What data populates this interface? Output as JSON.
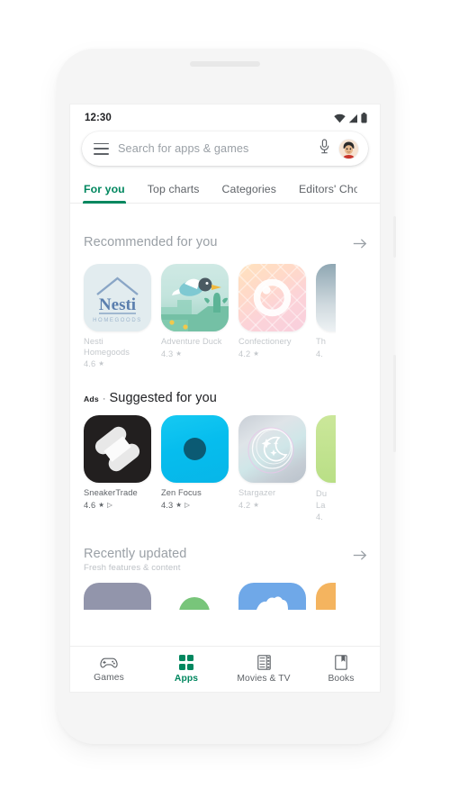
{
  "status_bar": {
    "time": "12:30",
    "icons": [
      "wifi-icon",
      "signal-icon",
      "battery-icon"
    ]
  },
  "search": {
    "menu_icon": "hamburger-menu-icon",
    "placeholder": "Search for apps & games",
    "mic_icon": "microphone-icon",
    "avatar": "user-avatar"
  },
  "tabs": [
    {
      "label": "For you",
      "active": true
    },
    {
      "label": "Top charts",
      "active": false
    },
    {
      "label": "Categories",
      "active": false
    },
    {
      "label": "Editors' Choi",
      "active": false
    }
  ],
  "colors": {
    "accent_green": "#01875f",
    "text_primary": "#202124",
    "text_secondary": "#5f6368",
    "text_muted": "#9aa0a6"
  },
  "sections": {
    "recommended": {
      "title": "Recommended for you",
      "arrow_icon": "arrow-right-icon",
      "apps": [
        {
          "name": "Nesti Homegoods",
          "rating": "4.6",
          "star": "★",
          "icon": "nesti-homegoods-icon"
        },
        {
          "name": "Adventure Duck",
          "rating": "4.3",
          "star": "★",
          "icon": "adventure-duck-icon"
        },
        {
          "name": "Confectionery",
          "rating": "4.2",
          "star": "★",
          "icon": "confectionery-icon"
        },
        {
          "name": "Th",
          "rating": "4.",
          "star": "",
          "icon": "partial-app-icon"
        }
      ]
    },
    "suggested": {
      "ads_tag": "Ads",
      "separator": "·",
      "title": "Suggested for you",
      "apps": [
        {
          "name": "SneakerTrade",
          "rating": "4.6",
          "star": "★",
          "badge": "▷",
          "icon": "sneakertrade-icon"
        },
        {
          "name": "Zen Focus",
          "rating": "4.3",
          "star": "★",
          "badge": "▷",
          "icon": "zen-focus-icon"
        },
        {
          "name": "Stargazer",
          "rating": "4.2",
          "star": "★",
          "badge": "",
          "icon": "stargazer-icon"
        },
        {
          "name": "Du La",
          "rating": "4.",
          "star": "",
          "badge": "",
          "icon": "partial-ad-icon"
        }
      ]
    },
    "recently_updated": {
      "title": "Recently updated",
      "subtitle": "Fresh features & content",
      "arrow_icon": "arrow-right-icon"
    }
  },
  "bottom_nav": [
    {
      "label": "Games",
      "icon": "gamepad-icon",
      "active": false
    },
    {
      "label": "Apps",
      "icon": "apps-grid-icon",
      "active": true
    },
    {
      "label": "Movies & TV",
      "icon": "film-strip-icon",
      "active": false
    },
    {
      "label": "Books",
      "icon": "book-bookmark-icon",
      "active": false
    }
  ]
}
